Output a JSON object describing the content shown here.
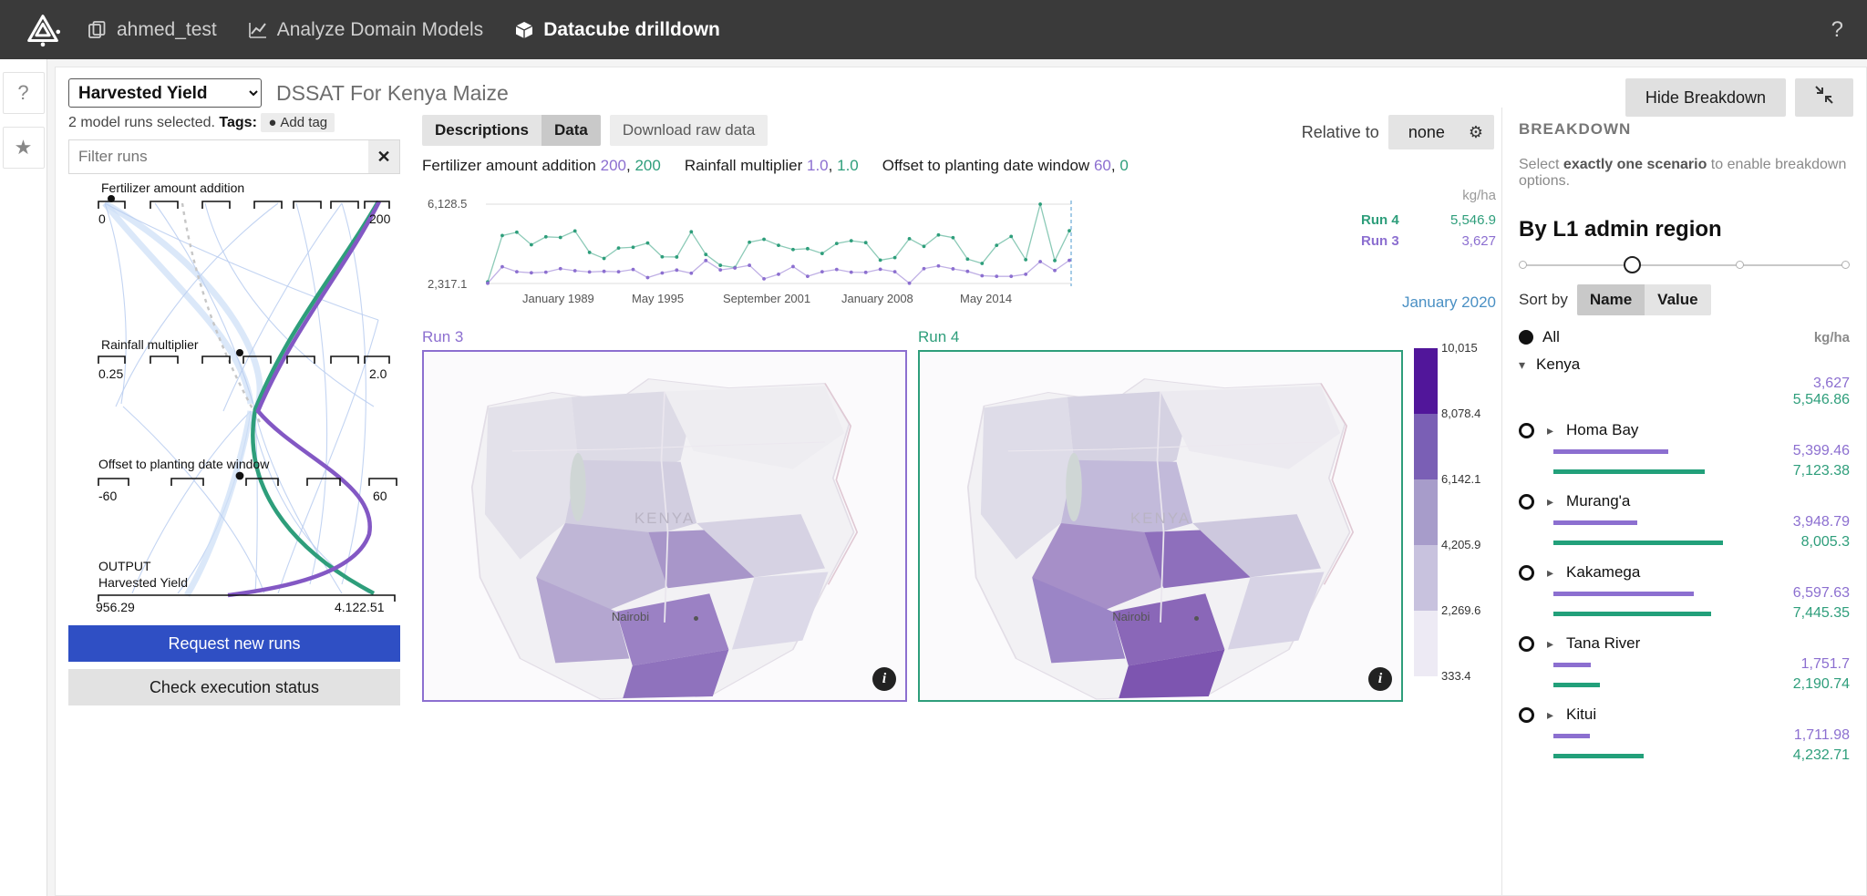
{
  "nav": {
    "logo_icon": "triangle-logo-icon",
    "items": [
      {
        "label": "ahmed_test",
        "icon": "copy-icon",
        "active": false
      },
      {
        "label": "Analyze Domain Models",
        "icon": "chart-line-icon",
        "active": false
      },
      {
        "label": "Datacube drilldown",
        "icon": "cube-icon",
        "active": true
      }
    ],
    "help_label": "?"
  },
  "rail": {
    "items": [
      {
        "icon": "question-icon",
        "label": "?"
      },
      {
        "icon": "star-icon",
        "label": "★"
      }
    ]
  },
  "header": {
    "select_value": "Harvested Yield",
    "select_options": [
      "Harvested Yield"
    ],
    "model_title": "DSSAT For Kenya Maize",
    "hide_breakdown_label": "Hide Breakdown",
    "collapse_icon": "collapse-arrows-icon"
  },
  "left": {
    "runs_text_pre": "2 model runs selected. ",
    "runs_text_bold": "Tags:",
    "add_tag_label": "Add tag",
    "add_tag_icon": "plus-circle-icon",
    "filter_placeholder": "Filter runs",
    "filter_value": "",
    "clear_icon": "close-icon",
    "request_runs_label": "Request new runs",
    "check_status_label": "Check execution status"
  },
  "parallel_coords": {
    "axes": [
      {
        "name": "Fertilizer amount addition",
        "min": "0",
        "max": "200"
      },
      {
        "name": "Rainfall multiplier",
        "min": "0.25",
        "max": "2.0"
      },
      {
        "name": "Offset to planting date window",
        "min": "-60",
        "max": "60"
      }
    ],
    "output_kicker": "OUTPUT",
    "output_name": "Harvested Yield",
    "output_min": "956.29",
    "output_max": "4,122.51"
  },
  "center": {
    "tabs": [
      {
        "label": "Descriptions",
        "active": false
      },
      {
        "label": "Data",
        "active": true
      }
    ],
    "download_label": "Download raw data",
    "relative_label": "Relative to",
    "relative_value": "none",
    "relative_gear_icon": "gear-icon",
    "params": [
      {
        "name": "Fertilizer amount addition",
        "run3": "200",
        "run4": "200"
      },
      {
        "name": "Rainfall multiplier",
        "run3": "1.0",
        "run4": "1.0"
      },
      {
        "name": "Offset to planting date window",
        "run3": "60",
        "run4": "0"
      }
    ],
    "maps": [
      {
        "label": "Run 3",
        "country_label": "KENYA",
        "city": "Nairobi",
        "info_icon": "info-icon"
      },
      {
        "label": "Run 4",
        "country_label": "KENYA",
        "city": "Nairobi",
        "info_icon": "info-icon"
      }
    ],
    "colorbar_ticks": [
      "10,015",
      "8,078.4",
      "6,142.1",
      "4,205.9",
      "2,269.6",
      "333.4"
    ]
  },
  "chart_data": {
    "type": "line",
    "title": "",
    "xlabel": "",
    "ylabel": "",
    "unit": "kg/ha",
    "ylim": [
      2317.1,
      6128.5
    ],
    "ytick_labels": [
      "6,128.5",
      "2,317.1"
    ],
    "xtick_labels": [
      "January 1989",
      "May 1995",
      "September 2001",
      "January 2008",
      "May 2014"
    ],
    "end_marker_label": "January 2020",
    "legend": [
      {
        "name": "Run 4",
        "value": "5,546.9",
        "color": "#2e9e7b"
      },
      {
        "name": "Run 3",
        "value": "3,627",
        "color": "#8c6fd0"
      }
    ],
    "series": [
      {
        "name": "Run 4",
        "color": "#2e9e7b",
        "values": [
          2390,
          4620,
          4780,
          4180,
          4560,
          4530,
          4840,
          3810,
          3520,
          4020,
          4060,
          4260,
          3600,
          3590,
          4800,
          3710,
          3190,
          3080,
          4300,
          4440,
          4150,
          3950,
          3990,
          3760,
          4240,
          4370,
          4280,
          3440,
          3560,
          4470,
          4100,
          4650,
          4520,
          3490,
          3280,
          4150,
          4580,
          3460,
          6128,
          3420,
          4850
        ]
      },
      {
        "name": "Run 3",
        "color": "#8c6fd0",
        "values": [
          2330,
          3120,
          2880,
          2830,
          2860,
          3030,
          2930,
          2870,
          2900,
          2880,
          2990,
          2600,
          2820,
          2960,
          2810,
          3420,
          2970,
          3060,
          3190,
          2540,
          2760,
          3130,
          2660,
          2880,
          2990,
          2860,
          2850,
          3000,
          2880,
          2330,
          3030,
          3160,
          3020,
          2900,
          2690,
          2660,
          2660,
          2760,
          3370,
          2940,
          3430
        ]
      }
    ]
  },
  "breakdown": {
    "title": "BREAKDOWN",
    "hint_pre": "Select ",
    "hint_bold": "exactly one scenario",
    "hint_post": " to enable breakdown options.",
    "heading": "By L1 admin region",
    "sort_label": "Sort by",
    "sort_options": [
      {
        "label": "Name",
        "active": true
      },
      {
        "label": "Value",
        "active": false
      }
    ],
    "all_label": "All",
    "unit": "kg/ha",
    "country": {
      "label": "Kenya",
      "chevron_icon": "chevron-down-icon",
      "run3": "3,627",
      "run4": "5,546.86"
    },
    "regions": [
      {
        "name": "Homa Bay",
        "run3": "5,399.46",
        "run4": "7,123.38",
        "run3_pct": 53.9,
        "run4_pct": 71.1
      },
      {
        "name": "Murang'a",
        "run3": "3,948.79",
        "run4": "8,005.3",
        "run3_pct": 39.4,
        "run4_pct": 79.9
      },
      {
        "name": "Kakamega",
        "run3": "6,597.63",
        "run4": "7,445.35",
        "run3_pct": 65.9,
        "run4_pct": 74.3
      },
      {
        "name": "Tana River",
        "run3": "1,751.7",
        "run4": "2,190.74",
        "run3_pct": 17.5,
        "run4_pct": 21.9
      },
      {
        "name": "Kitui",
        "run3": "1,711.98",
        "run4": "4,232.71",
        "run3_pct": 17.1,
        "run4_pct": 42.3
      }
    ],
    "expand_icon": "chevron-right-icon"
  },
  "colors": {
    "run3": "#8c6fd0",
    "run4": "#2e9e7b",
    "primary": "#2f4fc4",
    "topbar": "#3a3a3a"
  }
}
